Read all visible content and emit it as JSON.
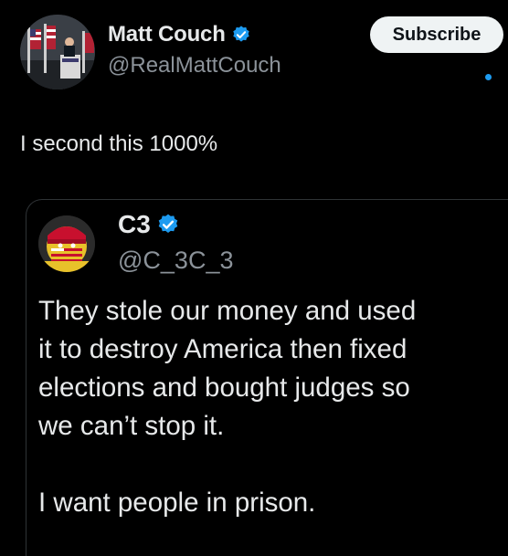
{
  "main_tweet": {
    "author_name": "Matt Couch",
    "author_handle": "@RealMattCouch",
    "subscribe_label": "Subscribe",
    "text": "I second this 1000%",
    "verified": true
  },
  "quoted_tweet": {
    "author_name": "C3",
    "author_handle": "@C_3C_3",
    "verified": true,
    "text_lines": [
      "They stole our money and used",
      "it to destroy America then fixed",
      "elections and bought judges so",
      "we can’t stop it."
    ],
    "text_final": "I want people in prison."
  },
  "colors": {
    "background": "#000000",
    "text_primary": "#e7e9ea",
    "text_secondary": "#8b9299",
    "accent": "#1d9bf0",
    "button_bg": "#eff3f4"
  },
  "icons": {
    "verified": "verified-badge-icon"
  }
}
